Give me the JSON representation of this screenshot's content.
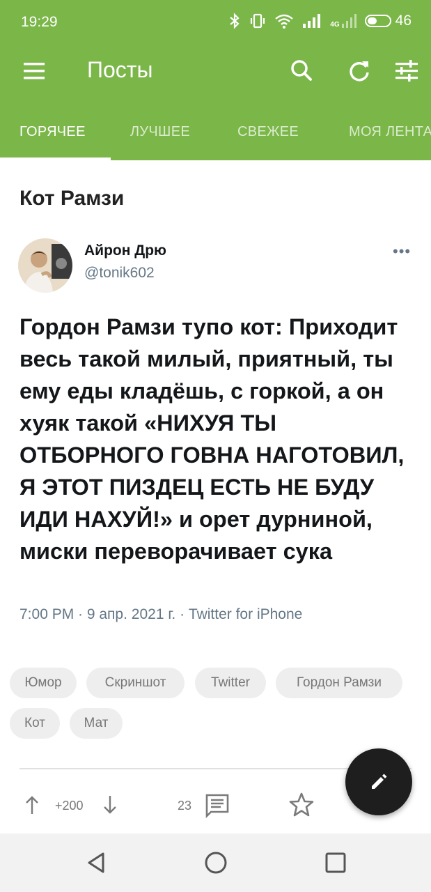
{
  "status_bar": {
    "time": "19:29",
    "network_label": "4G",
    "battery_percent": 46,
    "battery_text": "46",
    "icons": [
      "bluetooth-icon",
      "vibrate-icon",
      "wifi-icon",
      "signal-icon",
      "signal-4g-icon",
      "battery-icon"
    ]
  },
  "appbar": {
    "title": "Посты",
    "icons": [
      "menu-icon",
      "search-icon",
      "refresh-icon",
      "filter-icon"
    ]
  },
  "tabs": [
    {
      "label": "ГОРЯЧЕЕ",
      "active": true
    },
    {
      "label": "ЛУЧШЕЕ",
      "active": false
    },
    {
      "label": "СВЕЖЕЕ",
      "active": false
    },
    {
      "label": "МОЯ ЛЕНТА",
      "active": false
    }
  ],
  "post": {
    "title": "Кот Рамзи",
    "tweet": {
      "author": "Айрон Дрю",
      "handle": "@tonik602",
      "text": "Гордон Рамзи тупо кот: Приходит весь такой милый, приятный, ты ему еды кладёшь, с горкой, а он хуяк такой «НИХУЯ ТЫ ОТБОРНОГО ГОВНА НАГОТОВИЛ, Я ЭТОТ ПИЗДЕЦ ЕСТЬ НЕ БУДУ ИДИ НАХУЙ!» и орет дурниной, миски переворачивает сука",
      "meta": "7:00 PM · 9 апр. 2021 г. · Twitter for iPhone"
    },
    "tags": [
      "Юмор",
      "Скриншот",
      "Twitter",
      "Гордон Рамзи",
      "Кот",
      "Мат"
    ],
    "actions": {
      "rating": "+200",
      "comments": "23"
    }
  },
  "colors": {
    "brand_green": "#7ab648",
    "fab_background": "#1e1e1e"
  }
}
